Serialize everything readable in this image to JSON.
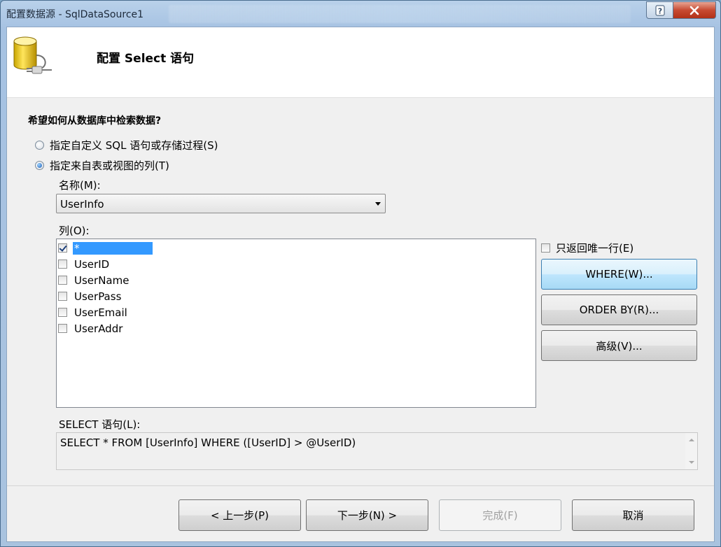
{
  "window": {
    "title": "配置数据源 - SqlDataSource1",
    "help_label": "?",
    "close_label": "X"
  },
  "header": {
    "title": "配置 Select 语句",
    "icon": "database-connect-icon"
  },
  "question": "希望如何从数据库中检索数据?",
  "options": {
    "custom_sql": {
      "label": "指定自定义 SQL 语句或存储过程(S)",
      "checked": false
    },
    "table_columns": {
      "label": "指定来自表或视图的列(T)",
      "checked": true
    }
  },
  "name_field": {
    "label": "名称(M):",
    "value": "UserInfo"
  },
  "columns": {
    "label": "列(O):",
    "items": [
      {
        "label": "*",
        "checked": true,
        "selected": true
      },
      {
        "label": "UserID",
        "checked": false,
        "selected": false
      },
      {
        "label": "UserName",
        "checked": false,
        "selected": false
      },
      {
        "label": "UserPass",
        "checked": false,
        "selected": false
      },
      {
        "label": "UserEmail",
        "checked": false,
        "selected": false
      },
      {
        "label": "UserAddr",
        "checked": false,
        "selected": false
      }
    ]
  },
  "unique_rows": {
    "label": "只返回唯一行(E)",
    "checked": false
  },
  "side_buttons": {
    "where": "WHERE(W)...",
    "order_by": "ORDER BY(R)...",
    "advanced": "高级(V)..."
  },
  "sql": {
    "label": "SELECT 语句(L):",
    "statement": "SELECT * FROM [UserInfo] WHERE ([UserID] > @UserID)"
  },
  "footer_buttons": {
    "previous": "< 上一步(P)",
    "next": "下一步(N) >",
    "finish": "完成(F)",
    "cancel": "取消"
  },
  "colors": {
    "selection": "#3399ff",
    "client_bg": "#f0f0f0",
    "close_red": "#c74a32"
  }
}
